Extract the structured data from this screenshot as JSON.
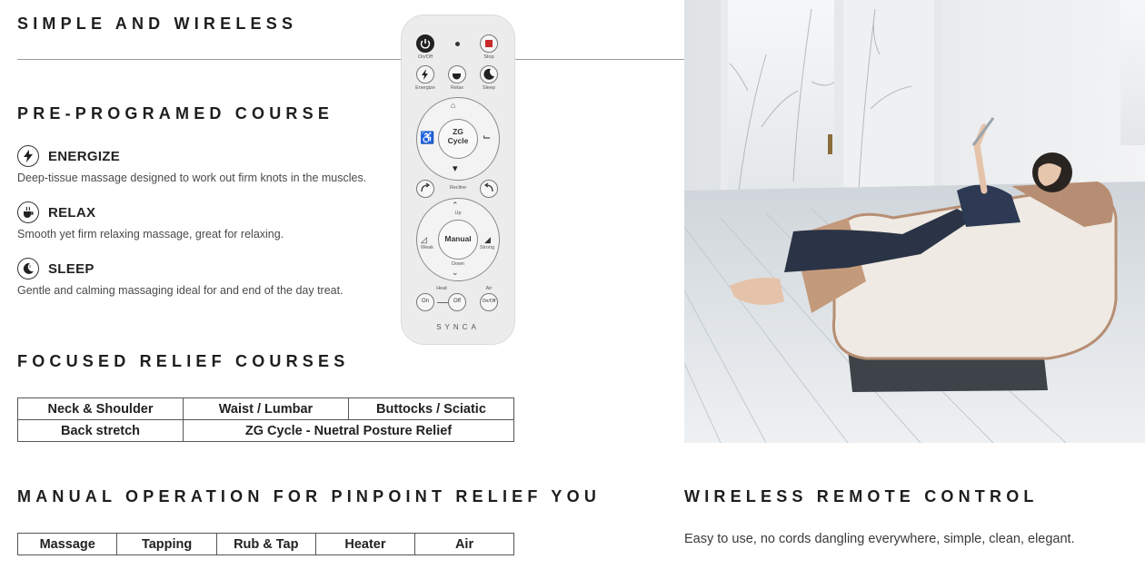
{
  "headings": {
    "simple_wireless": "SIMPLE AND WIRELESS",
    "preprogramed": "PRE-PROGRAMED COURSE",
    "focused": "FOCUSED RELIEF COURSES",
    "manual": "MANUAL OPERATION FOR PINPOINT RELIEF YOU",
    "wireless": "WIRELESS REMOTE CONTROL"
  },
  "courses": [
    {
      "title": "ENERGIZE",
      "desc": "Deep-tissue massage designed to work out firm knots in the muscles.",
      "icon": "lightning-icon"
    },
    {
      "title": "RELAX",
      "desc": "Smooth yet firm relaxing massage, great for relaxing.",
      "icon": "cup-icon"
    },
    {
      "title": "SLEEP",
      "desc": "Gentle and calming massaging ideal for and end of the day treat.",
      "icon": "moon-icon"
    }
  ],
  "focused_table": {
    "row1": [
      "Neck & Shoulder",
      "Waist / Lumbar",
      "Buttocks / Sciatic"
    ],
    "row2": [
      "Back stretch",
      "ZG Cycle - Nuetral Posture Relief"
    ]
  },
  "manual_table": [
    "Massage",
    "Tapping",
    "Rub & Tap",
    "Heater",
    "Air"
  ],
  "wireless_desc": "Easy to use, no cords dangling everywhere, simple, clean, elegant.",
  "remote": {
    "onoff": "On/Off",
    "stop": "Stop",
    "energize": "Energize",
    "relax": "Relax",
    "sleep": "Sleep",
    "zg_line1": "ZG",
    "zg_line2": "Cycle",
    "recline": "Recline",
    "manual": "Manual",
    "up": "Up",
    "down": "Down",
    "weak": "Weak",
    "strong": "Strong",
    "heat": "Heat",
    "air": "Air",
    "on": "On",
    "off": "Off",
    "air_onoff": "On/Off",
    "brand": "SYNCA"
  },
  "colors": {
    "text": "#222222",
    "remote_body": "#ececec",
    "chair_body": "#efeae3",
    "chair_accent": "#b78e73"
  }
}
